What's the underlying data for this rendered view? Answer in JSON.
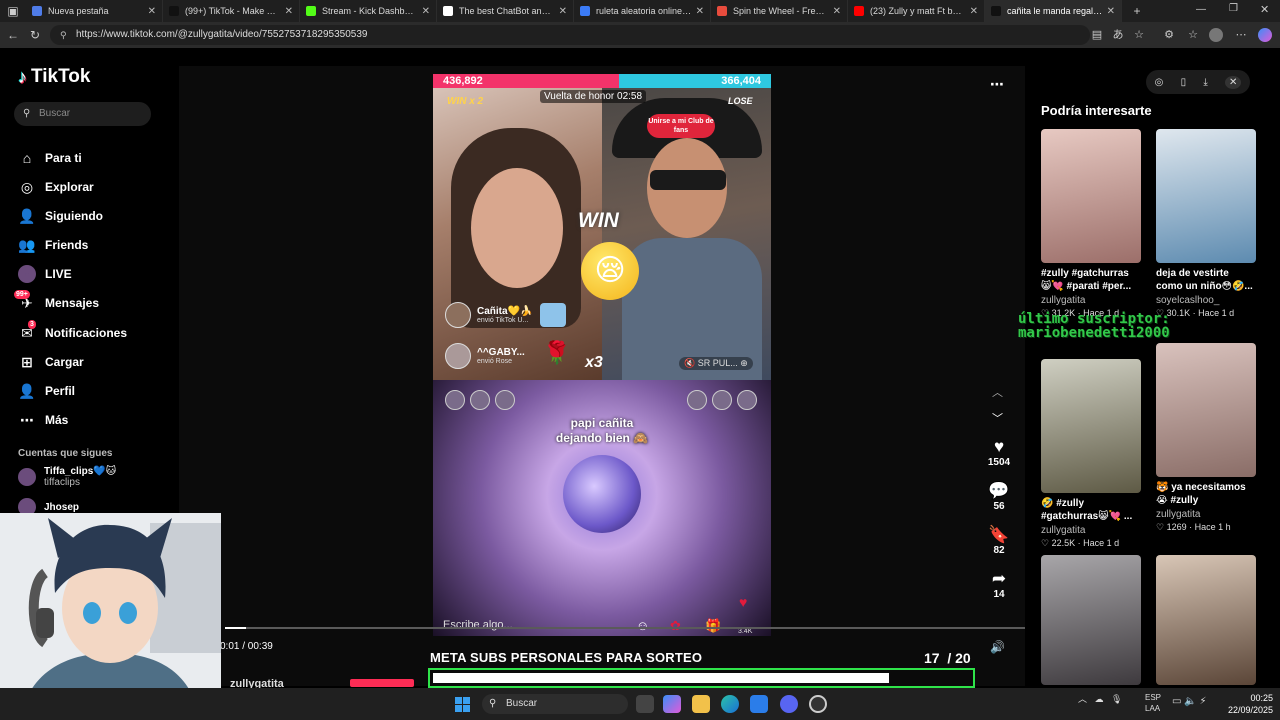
{
  "browser": {
    "tabs": [
      {
        "label": "Nueva pestaña",
        "color": "#4f7ce8"
      },
      {
        "label": "(99+) TikTok - Make Your Day",
        "color": "#111111"
      },
      {
        "label": "Stream - Kick Dashboard",
        "color": "#53fc18"
      },
      {
        "label": "The best ChatBot and Widgets",
        "color": "#ffffff"
      },
      {
        "label": "ruleta aleatoria online - Búsqueda",
        "color": "#3b7bf6"
      },
      {
        "label": "Spin the Wheel - Free and",
        "color": "#e84c3d"
      },
      {
        "label": "(23) Zully y matt Ft baile in",
        "color": "#ff0000"
      },
      {
        "label": "cañita le manda regalos a",
        "color": "#111111"
      }
    ],
    "url": "https://www.tiktok.com/@zullygatita/video/7552753718295350539"
  },
  "sidebar": {
    "logo": "TikTok",
    "search_placeholder": "Buscar",
    "nav": [
      {
        "label": "Para ti",
        "icon": "home-icon"
      },
      {
        "label": "Explorar",
        "icon": "compass-icon"
      },
      {
        "label": "Siguiendo",
        "icon": "following-icon"
      },
      {
        "label": "Friends",
        "icon": "friends-icon"
      },
      {
        "label": "LIVE",
        "icon": "live-icon"
      },
      {
        "label": "Mensajes",
        "icon": "messages-icon",
        "badge": "99+"
      },
      {
        "label": "Notificaciones",
        "icon": "notifications-icon",
        "badge": "3"
      },
      {
        "label": "Cargar",
        "icon": "upload-icon"
      },
      {
        "label": "Perfil",
        "icon": "profile-icon"
      },
      {
        "label": "Más",
        "icon": "more-icon"
      }
    ],
    "following_title": "Cuentas que sigues",
    "following": [
      {
        "name": "Tiffa_clips💙🐱",
        "handle": "tiffaclips"
      },
      {
        "name": "Jhosep",
        "handle": ""
      }
    ]
  },
  "video": {
    "score_left": "436,892",
    "score_right": "366,404",
    "win_label": "WIN x 2",
    "lose_label": "LOSE",
    "honor_label": "Vuelta de honor 02:58",
    "club_button": "Unirse a mi Club de fans",
    "big_win": "WIN",
    "gift1_name": "Cañita💛🍌",
    "gift1_sub": "envió TikTok U...",
    "gift2_name": "^^GABY...",
    "gift2_sub": "envió Rose",
    "multiplier": "x3",
    "host_tag": "SR PUL...",
    "caption_line1": "papi cañita",
    "caption_line2": "dejando bien 🙈",
    "comment_placeholder": "Escribe algo...",
    "gift_count": "3.4K",
    "time": "0:01 / 00:39",
    "progress": 0.026
  },
  "actions": {
    "likes": "1504",
    "comments": "56",
    "saves": "82",
    "shares": "14"
  },
  "goal": {
    "title": "META SUBS PERSONALES PARA SORTEO",
    "current": "17",
    "total": "/ 20",
    "fraction": 0.85
  },
  "author_peek": "zullygatita",
  "right": {
    "title": "Podría interesarte",
    "cards": [
      {
        "desc": "#zully #gatchurras 😸💘 #parati #per...",
        "user": "zullygatita",
        "meta": "♡ 31.2K · Hace 1 d",
        "c1": "#e7c9c2",
        "c2": "#9c6f6a"
      },
      {
        "desc": "deja de vestirte como un niño😳🤣...",
        "user": "soyelcaslhoo_",
        "meta": "♡ 30.1K · Hace 1 d",
        "c1": "#dfe7ee",
        "c2": "#5d8bb0"
      },
      {
        "desc": "🤣 #zully #gatchurras😸💘 ...",
        "user": "zullygatita",
        "meta": "♡ 22.5K · Hace 1 d",
        "c1": "#cfcfc2",
        "c2": "#5e5a45"
      },
      {
        "desc": "🐯 ya necesitamos 😭 #zully #gatchurras...",
        "user": "zullygatita",
        "meta": "♡ 1269 · Hace 1 h",
        "c1": "#d9c2bd",
        "c2": "#8a6d67"
      },
      {
        "desc": "",
        "user": "",
        "meta": "",
        "c1": "#a8a6a9",
        "c2": "#3e3a3e"
      },
      {
        "desc": "",
        "user": "",
        "meta": "",
        "c1": "#d8c6b6",
        "c2": "#5b4638"
      }
    ]
  },
  "overlay_text": "último suscriptor: mariobenedetti2000",
  "taskbar": {
    "search": "Buscar",
    "lang1": "ESP",
    "lang2": "LAA",
    "time": "00:25",
    "date": "22/09/2025"
  },
  "colors": {
    "accent": "#fe2c55",
    "battle_left": "#f3336a",
    "battle_right": "#2ec8e0",
    "goal_border": "#2fe44a"
  }
}
